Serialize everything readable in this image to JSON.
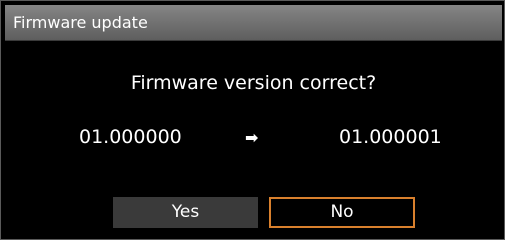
{
  "dialog": {
    "title": "Firmware update",
    "question": "Firmware version correct?",
    "current_version": "01.000000",
    "arrow_glyph": "➡",
    "new_version": "01.000001",
    "yes_label": "Yes",
    "no_label": "No",
    "selected_button": "No"
  },
  "colors": {
    "background": "#000000",
    "titlebar_top": "#858585",
    "titlebar_bottom": "#5e5e5e",
    "text": "#ffffff",
    "button_fill": "#3a3a3a",
    "focus_border": "#d9802d"
  },
  "icons": {
    "arrow": "arrow-right-icon"
  }
}
